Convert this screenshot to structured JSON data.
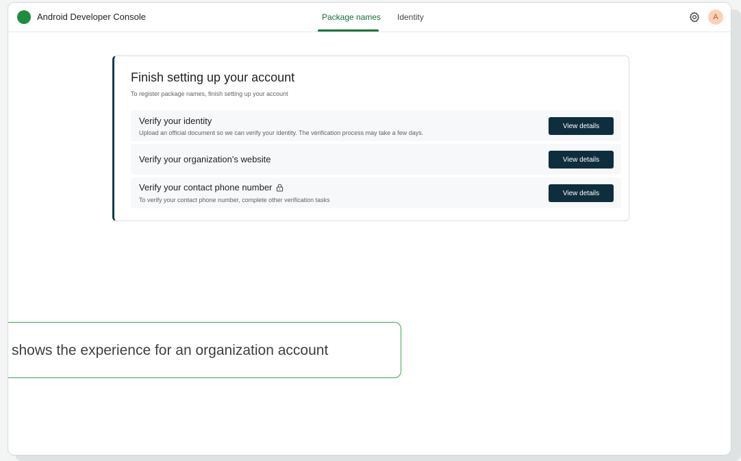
{
  "header": {
    "app_title": "Android Developer Console",
    "tabs": [
      {
        "label": "Package names",
        "active": true
      },
      {
        "label": "Identity",
        "active": false
      }
    ],
    "settings_icon": "gear-icon",
    "avatar_initial": "A",
    "brand_color": "#1e8e3e",
    "active_tab_color": "#137333"
  },
  "card": {
    "title": "Finish setting up your account",
    "subtitle": "To register package names, finish setting up your account",
    "accent_color": "#0e3a4a",
    "tasks": [
      {
        "title": "Verify your identity",
        "description": "Upload an official document so we can verify your identity. The verification process may take a few days.",
        "button_label": "View details",
        "locked": false
      },
      {
        "title": "Verify your organization's website",
        "description": "",
        "button_label": "View details",
        "locked": false
      },
      {
        "title": "Verify your contact phone number",
        "description": "To verify your contact phone number, complete other verification tasks",
        "button_label": "View details",
        "locked": true,
        "lock_icon": "lock-icon"
      }
    ]
  },
  "callout": {
    "text": "shows the experience for an organization account",
    "border_color": "#34a853"
  }
}
